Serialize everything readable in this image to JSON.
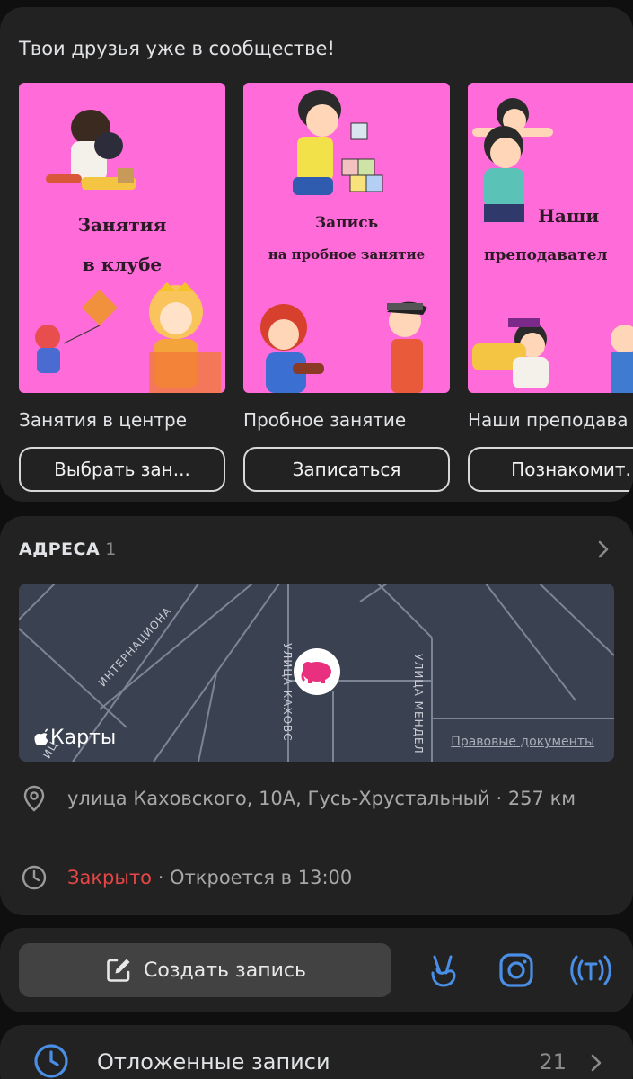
{
  "friends": {
    "heading": "Твои друзья уже в сообществе!",
    "tiles": [
      {
        "cover_line1": "Занятия",
        "cover_line2": "в клубе",
        "caption": "Занятия в центре",
        "button": "Выбрать зан..."
      },
      {
        "cover_line1": "Запись",
        "cover_line2": "на пробное занятие",
        "caption": "Пробное занятие",
        "button": "Записаться"
      },
      {
        "cover_line1": "Наши",
        "cover_line2": "преподавател",
        "caption": "Наши преподава",
        "button": "Познакомит."
      }
    ]
  },
  "addresses": {
    "title": "АДРЕСА",
    "count": "1",
    "map": {
      "streets": [
        "ИНТЕРНАЦИОНА",
        "УЛИЦА КАХОВС",
        "УЛИЦА МЕНДЕЛ",
        "ИЦ"
      ],
      "logo_label": "Карты",
      "legal_link": "Правовые документы"
    },
    "address": "улица Каховского, 10А, Гусь-Хрустальный · 257 км",
    "status_closed": "Закрыто",
    "status_opens": " · Откроется в 13:00"
  },
  "actions": {
    "create_post": "Создать запись"
  },
  "postponed": {
    "label": "Отложенные записи",
    "count": "21"
  },
  "colors": {
    "card_bg": "#222222",
    "cover_pink": "#ff6bd9",
    "accent_blue": "#3f8ae0",
    "closed_red": "#e64646",
    "map_bg": "#3a4150"
  },
  "icons": [
    "location-pin-icon",
    "clock-icon",
    "edit-icon",
    "clips-icon",
    "instagram-icon",
    "broadcast-icon",
    "chevron-right-icon"
  ]
}
